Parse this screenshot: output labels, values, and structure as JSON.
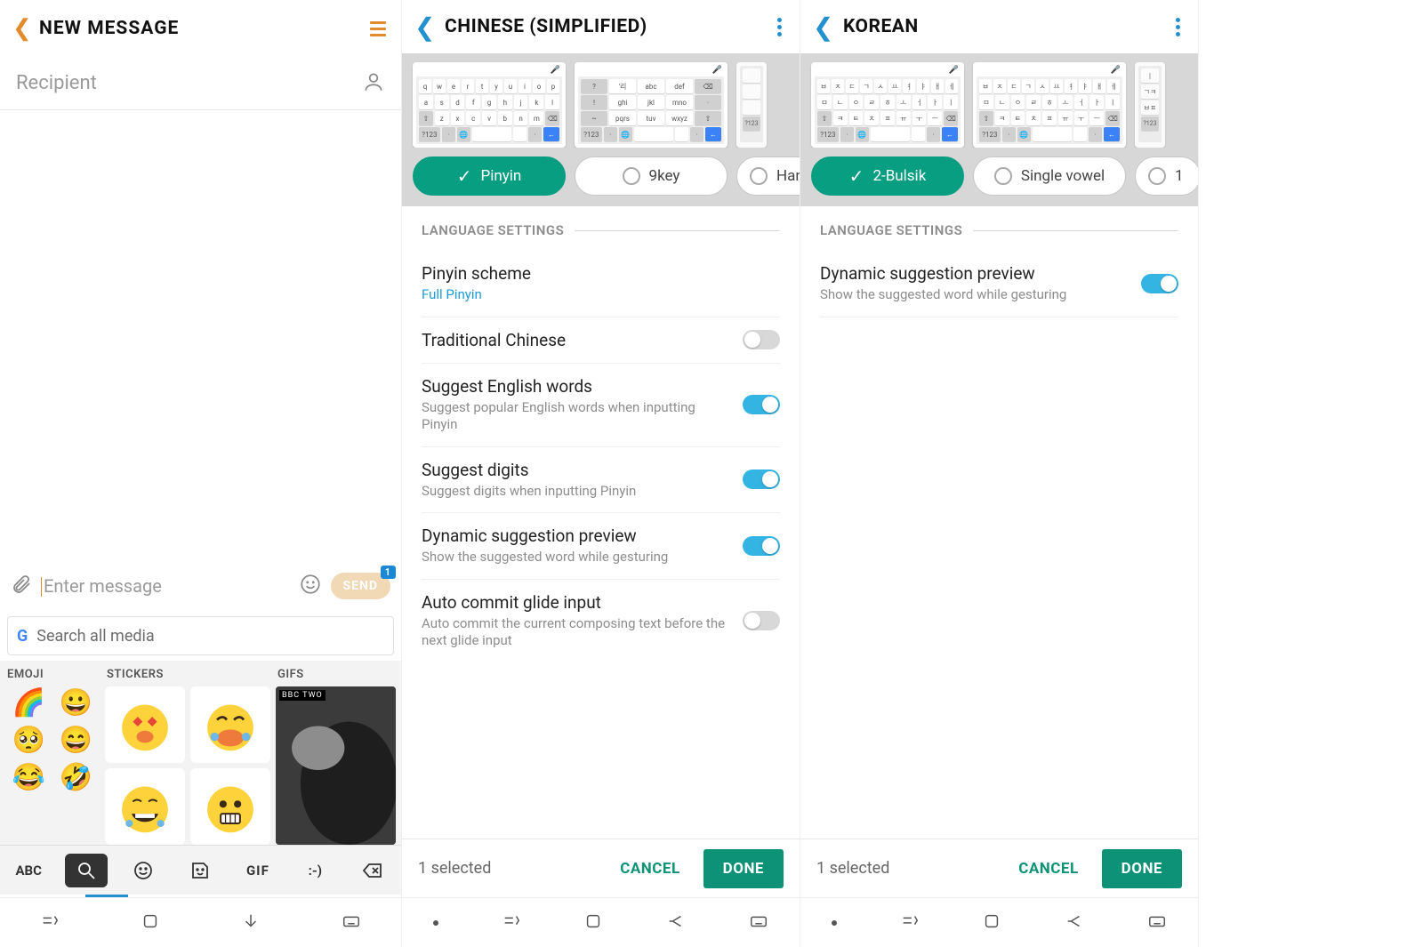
{
  "panel1": {
    "title": "NEW MESSAGE",
    "recipient_placeholder": "Recipient",
    "compose_placeholder": "Enter message",
    "send_label": "SEND",
    "send_badge": "1",
    "search_placeholder": "Search all media",
    "tabs": {
      "emoji": "EMOJI",
      "stickers": "STICKERS",
      "gifs": "GIFS"
    },
    "emoji_items": [
      "🌈",
      "😀",
      "🥺",
      "😄",
      "😂",
      "🤣"
    ],
    "gif_tag": "BBC TWO",
    "bottom_bar": {
      "abc": "ABC",
      "gif": "GIF",
      "text_face": ":-)"
    }
  },
  "panel2": {
    "title": "CHINESE (SIMPLIFIED)",
    "chips": [
      "Pinyin",
      "9key",
      "Han"
    ],
    "section": "LANGUAGE SETTINGS",
    "settings": [
      {
        "title": "Pinyin scheme",
        "sub": "Full Pinyin",
        "type": "link"
      },
      {
        "title": "Traditional Chinese",
        "type": "toggle",
        "on": false
      },
      {
        "title": "Suggest English words",
        "sub": "Suggest popular English words when inputting Pinyin",
        "type": "toggle",
        "on": true
      },
      {
        "title": "Suggest digits",
        "sub": "Suggest digits when inputting Pinyin",
        "type": "toggle",
        "on": true
      },
      {
        "title": "Dynamic suggestion preview",
        "sub": "Show the suggested word while gesturing",
        "type": "toggle",
        "on": true
      },
      {
        "title": "Auto commit glide input",
        "sub": "Auto commit the current composing text before the next glide input",
        "type": "toggle",
        "on": false
      }
    ],
    "thumb9": {
      "r1": [
        "?",
        "'리",
        "abc",
        "def",
        "⌫"
      ],
      "r2": [
        "!",
        "ghi",
        "jkl",
        "mno",
        "·"
      ],
      "r3": [
        "~",
        "pqrs",
        "tuv",
        "wxyz",
        "⇧"
      ]
    },
    "footer": {
      "selected": "1 selected",
      "cancel": "CANCEL",
      "done": "DONE"
    }
  },
  "panel3": {
    "title": "KOREAN",
    "chips": [
      "2-Bulsik",
      "Single vowel",
      "1"
    ],
    "section": "LANGUAGE SETTINGS",
    "settings": [
      {
        "title": "Dynamic suggestion preview",
        "sub": "Show the suggested word while gesturing",
        "type": "toggle",
        "on": true
      }
    ],
    "footer": {
      "selected": "1 selected",
      "cancel": "CANCEL",
      "done": "DONE"
    }
  },
  "qwerty": {
    "r1": [
      "q",
      "w",
      "e",
      "r",
      "t",
      "y",
      "u",
      "i",
      "o",
      "p"
    ],
    "r2": [
      "a",
      "s",
      "d",
      "f",
      "g",
      "h",
      "j",
      "k",
      "l"
    ],
    "r3": [
      "⇧",
      "z",
      "x",
      "c",
      "v",
      "b",
      "n",
      "m",
      "⌫"
    ],
    "r4": [
      "?123",
      "·",
      "🌐",
      "",
      "",
      "·",
      "←"
    ]
  },
  "kor": {
    "r1": [
      "ㅂ",
      "ㅈ",
      "ㄷ",
      "ㄱ",
      "ㅅ",
      "ㅛ",
      "ㅕ",
      "ㅑ",
      "ㅐ",
      "ㅔ"
    ],
    "r2": [
      "ㅁ",
      "ㄴ",
      "ㅇ",
      "ㄹ",
      "ㅎ",
      "ㅗ",
      "ㅓ",
      "ㅏ",
      "ㅣ"
    ],
    "r3": [
      "⇧",
      "ㅋ",
      "ㅌ",
      "ㅊ",
      "ㅍ",
      "ㅠ",
      "ㅜ",
      "ㅡ",
      "⌫"
    ]
  },
  "kor2": {
    "r1": [
      "",
      "",
      "",
      "|",
      "",
      "",
      ""
    ],
    "r2": [
      "",
      "",
      "",
      "ㄱㅋ",
      "",
      "",
      ""
    ],
    "r3": [
      "",
      "",
      "",
      "ㅂㅍ",
      "",
      "",
      ""
    ]
  }
}
